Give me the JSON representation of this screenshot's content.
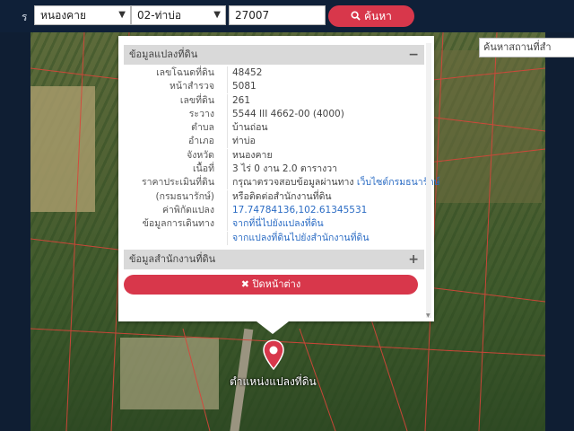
{
  "topbar": {
    "partial_label": "ร",
    "province_value": "หนองคาย",
    "district_value": "02-ท่าบ่อ",
    "parcel_value": "27007",
    "search_label": "ค้นหา"
  },
  "map": {
    "search_place_placeholder": "ค้นหาสถานที่สำ",
    "marker_label": "ตำแหน่งแปลงที่ดิน"
  },
  "popup": {
    "section1_title": "ข้อมูลแปลงที่ดิน",
    "section1_toggle": "−",
    "rows": [
      {
        "label": "เลขโฉนดที่ดิน",
        "value": "48452"
      },
      {
        "label": "หน้าสำรวจ",
        "value": "5081"
      },
      {
        "label": "เลขที่ดิน",
        "value": "261"
      },
      {
        "label": "ระวาง",
        "value": "5544 III 4662-00 (4000)"
      },
      {
        "label": "ตำบล",
        "value": "บ้านถ่อน"
      },
      {
        "label": "อำเภอ",
        "value": "ท่าบ่อ"
      },
      {
        "label": "จังหวัด",
        "value": "หนองคาย"
      },
      {
        "label": "เนื้อที่",
        "value": "3 ไร่ 0 งาน 2.0 ตารางวา"
      },
      {
        "label": "ราคาประเมินที่ดิน",
        "value": "กรุณาตรวจสอบข้อมูลผ่านทาง",
        "link": "เว็บไซต์กรมธนารักษ์"
      },
      {
        "label": "(กรมธนารักษ์)",
        "value": "หรือติดต่อสำนักงานที่ดิน"
      },
      {
        "label": "ค่าพิกัดแปลง",
        "link": "17.74784136,102.61345531"
      },
      {
        "label": "ข้อมูลการเดินทาง",
        "link": "จากที่นี่ไปยังแปลงที่ดิน"
      },
      {
        "label": "",
        "link": "จากแปลงที่ดินไปยังสำนักงานที่ดิน"
      }
    ],
    "section2_title": "ข้อมูลสำนักงานที่ดิน",
    "section2_toggle": "+",
    "close_label": "✖ ปิดหน้าต่าง"
  },
  "icons": {
    "search": "search-icon",
    "close": "close-icon",
    "marker": "map-marker-icon",
    "chevron": "chevron-down-icon"
  },
  "colors": {
    "accent": "#d8374b",
    "link": "#2b6cc4",
    "topbar": "#0f2038"
  }
}
